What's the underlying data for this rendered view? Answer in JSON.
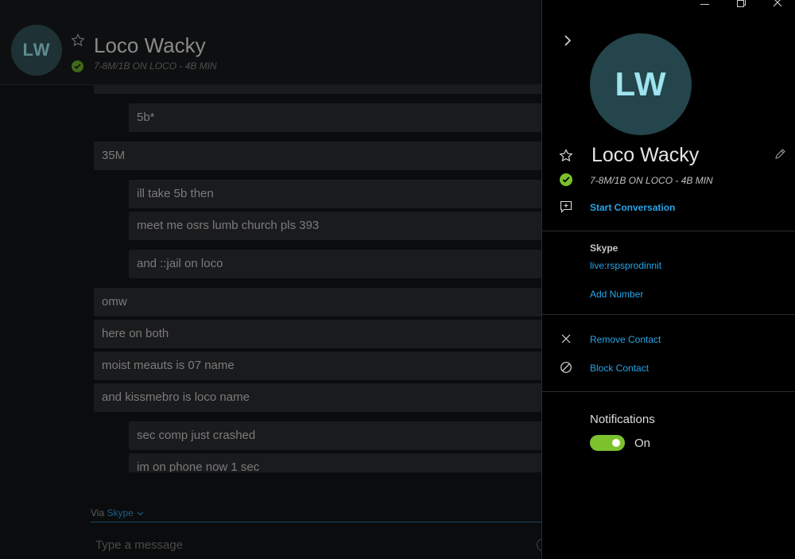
{
  "chat": {
    "contact_initials": "LW",
    "contact_name": "Loco Wacky",
    "status_text": "7-8M/1B ON LOCO - 4B MIN",
    "messages": [
      {
        "text": "5b*",
        "dir": "out"
      },
      {
        "text": "35M",
        "dir": "in"
      },
      {
        "text": "ill take 5b then",
        "dir": "out"
      },
      {
        "text": "meet me osrs lumb church pls 393",
        "dir": "out"
      },
      {
        "text": "and ::jail on loco",
        "dir": "out"
      },
      {
        "text": "omw",
        "dir": "in"
      },
      {
        "text": "here on both",
        "dir": "in"
      },
      {
        "text": "moist meauts is 07 name",
        "dir": "in"
      },
      {
        "text": "and kissmebro is loco name",
        "dir": "in"
      },
      {
        "text": "sec comp just crashed",
        "dir": "out"
      },
      {
        "text": "im on phone now 1 sec",
        "dir": "out"
      }
    ],
    "via_label": "Via",
    "via_service": "Skype",
    "compose_placeholder": "Type a message"
  },
  "panel": {
    "initials": "LW",
    "name": "Loco Wacky",
    "status_text": "7-8M/1B ON LOCO - 4B MIN",
    "start_conversation": "Start Conversation",
    "skype_label": "Skype",
    "skype_id": "live:rspsprodinnit",
    "add_number": "Add Number",
    "remove_contact": "Remove Contact",
    "block_contact": "Block Contact",
    "notifications_label": "Notifications",
    "notifications_state": "On"
  },
  "colors": {
    "accent_link": "#27a5e8",
    "online_green": "#7cc22d",
    "avatar_bg": "#24454b",
    "avatar_text": "#9fe3ee"
  },
  "icons": [
    "star-icon",
    "online-check-icon",
    "chevron-right-icon",
    "edit-pencil-icon",
    "new-conversation-icon",
    "close-x-icon",
    "block-icon",
    "minimize-icon",
    "restore-icon",
    "close-window-icon",
    "chevron-down-icon"
  ]
}
